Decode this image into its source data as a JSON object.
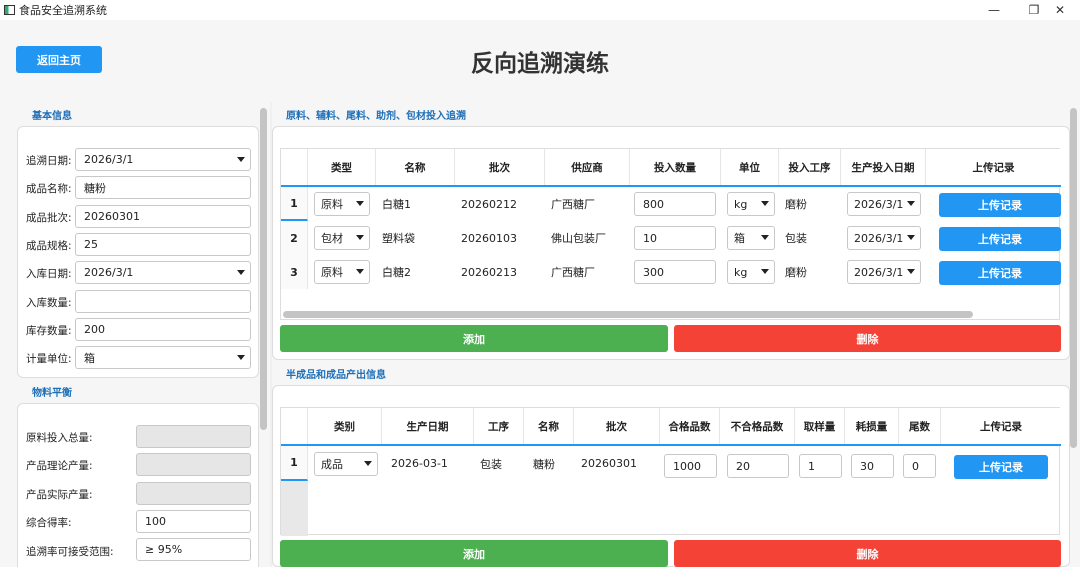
{
  "window": {
    "title": "食品安全追溯系统",
    "minimize": "—",
    "restore": "❐",
    "close": "✕"
  },
  "header": {
    "back_label": "返回主页",
    "page_title": "反向追溯演练"
  },
  "basic_info": {
    "title": "基本信息",
    "fields": {
      "trace_date": {
        "label": "追溯日期:",
        "value": "2026/3/1"
      },
      "product_name": {
        "label": "成品名称:",
        "value": "糖粉"
      },
      "product_batch": {
        "label": "成品批次:",
        "value": "20260301"
      },
      "product_spec": {
        "label": "成品规格:",
        "value": "25"
      },
      "stock_in_date": {
        "label": "入库日期:",
        "value": "2026/3/1"
      },
      "stock_in_qty": {
        "label": "入库数量:",
        "value": ""
      },
      "inventory_qty": {
        "label": "库存数量:",
        "value": "200"
      },
      "unit": {
        "label": "计量单位:",
        "value": "箱"
      }
    }
  },
  "material_balance": {
    "title": "物料平衡",
    "fields": {
      "raw_total": {
        "label": "原料投入总量:",
        "value": ""
      },
      "theory_output": {
        "label": "产品理论产量:",
        "value": ""
      },
      "actual_output": {
        "label": "产品实际产量:",
        "value": ""
      },
      "yield_rate": {
        "label": "综合得率:",
        "value": "100"
      },
      "trace_range": {
        "label": "追溯率可接受范围:",
        "value": "≥ 95%"
      }
    }
  },
  "inputs_section": {
    "title": "原料、辅料、尾料、助剂、包材投入追溯",
    "headers": [
      "类型",
      "名称",
      "批次",
      "供应商",
      "投入数量",
      "单位",
      "投入工序",
      "生产投入日期",
      "上传记录"
    ],
    "rows": [
      {
        "num": "1",
        "type": "原料",
        "name": "白糖1",
        "batch": "20260212",
        "supplier": "广西糖厂",
        "qty": "800",
        "unit": "kg",
        "process": "磨粉",
        "date": "2026/3/1",
        "upload": "上传记录"
      },
      {
        "num": "2",
        "type": "包材",
        "name": "塑料袋",
        "batch": "20260103",
        "supplier": "佛山包装厂",
        "qty": "10",
        "unit": "箱",
        "process": "包装",
        "date": "2026/3/1",
        "upload": "上传记录"
      },
      {
        "num": "3",
        "type": "原料",
        "name": "白糖2",
        "batch": "20260213",
        "supplier": "广西糖厂",
        "qty": "300",
        "unit": "kg",
        "process": "磨粉",
        "date": "2026/3/1",
        "upload": "上传记录"
      }
    ],
    "add_label": "添加",
    "delete_label": "删除"
  },
  "output_section": {
    "title": "半成品和成品产出信息",
    "headers": [
      "类别",
      "生产日期",
      "工序",
      "名称",
      "批次",
      "合格品数",
      "不合格品数",
      "取样量",
      "耗损量",
      "尾数",
      "上传记录"
    ],
    "rows": [
      {
        "num": "1",
        "category": "成品",
        "date": "2026-03-1",
        "process": "包装",
        "name": "糖粉",
        "batch": "20260301",
        "qualified": "1000",
        "unqualified": "20",
        "sample": "1",
        "loss": "30",
        "tail": "0",
        "upload": "上传记录"
      }
    ],
    "add_label": "添加",
    "delete_label": "删除"
  }
}
